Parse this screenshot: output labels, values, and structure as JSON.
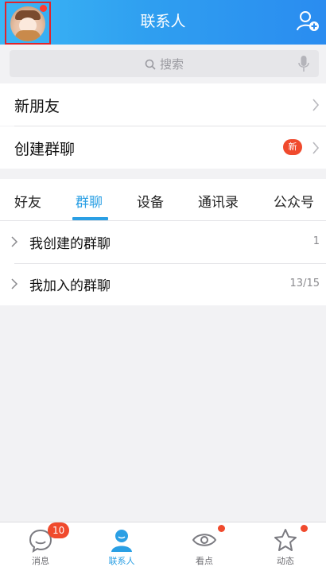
{
  "header": {
    "title": "联系人",
    "avatar_icon": "user-avatar",
    "add_contact_icon": "add-person-icon",
    "accent": "#2a9fe4"
  },
  "search": {
    "placeholder": "搜索",
    "icon": "search-icon",
    "mic_icon": "mic-icon"
  },
  "top_items": [
    {
      "label": "新朋友"
    },
    {
      "label": "创建群聊",
      "badge": "新"
    }
  ],
  "tabs": [
    {
      "label": "好友"
    },
    {
      "label": "群聊",
      "active": true
    },
    {
      "label": "设备"
    },
    {
      "label": "通讯录"
    },
    {
      "label": "公众号"
    }
  ],
  "groups": [
    {
      "label": "我创建的群聊",
      "count": "1"
    },
    {
      "label": "我加入的群聊",
      "count": "13/15"
    }
  ],
  "tabbar": [
    {
      "label": "消息",
      "icon": "message-icon",
      "badge": "10"
    },
    {
      "label": "联系人",
      "icon": "contacts-icon",
      "active": true
    },
    {
      "label": "看点",
      "icon": "eye-icon",
      "dot": true
    },
    {
      "label": "动态",
      "icon": "star-icon",
      "dot": true
    }
  ]
}
